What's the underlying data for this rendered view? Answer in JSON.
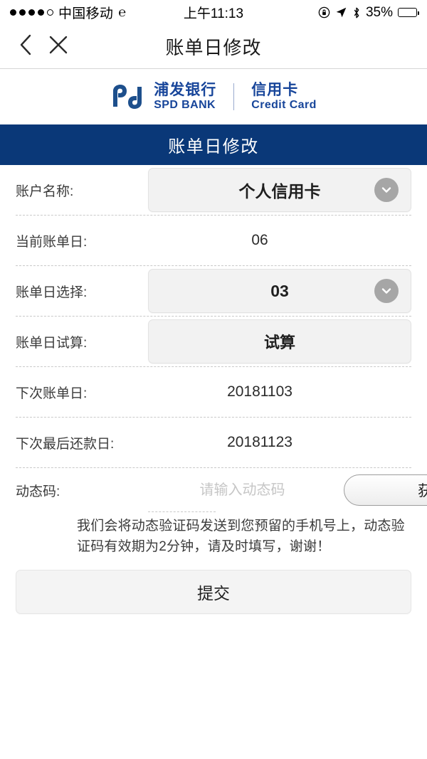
{
  "status_bar": {
    "signal_dots_filled": 4,
    "signal_dots_total": 5,
    "carrier": "中国移动",
    "network_icon": "edge-icon",
    "time": "上午11:13",
    "rotation_lock_icon": "rotation-lock-icon",
    "location_icon": "location-arrow-icon",
    "bluetooth_icon": "bluetooth-icon",
    "battery_percent": "35%",
    "battery_level": 35
  },
  "nav": {
    "back_icon": "chevron-left-icon",
    "close_icon": "close-x-icon",
    "title": "账单日修改"
  },
  "logo": {
    "mark": "spd-pd-logo-icon",
    "name_cn": "浦发银行",
    "name_en": "SPD BANK",
    "product_cn": "信用卡",
    "product_en": "Credit Card",
    "brand_color": "#17459a"
  },
  "banner": {
    "title": "账单日修改",
    "background": "#0a3878"
  },
  "form": {
    "rows": [
      {
        "label": "账户名称:",
        "type": "select",
        "value": "个人信用卡",
        "icon": "chevron-down-circle-icon"
      },
      {
        "label": "当前账单日:",
        "type": "text",
        "value": "06"
      },
      {
        "label": "账单日选择:",
        "type": "select",
        "value": "03",
        "icon": "chevron-down-circle-icon"
      },
      {
        "label": "账单日试算:",
        "type": "button",
        "value": "试算"
      },
      {
        "label": "下次账单日:",
        "type": "text",
        "value": "20181103"
      },
      {
        "label": "下次最后还款日:",
        "type": "text",
        "value": "20181123"
      }
    ],
    "code_row": {
      "label": "动态码:",
      "placeholder": "请输入动态码",
      "value": "",
      "get_button": "获取"
    },
    "hint": "我们会将动态验证码发送到您预留的手机号上，动态验证码有效期为2分钟，请及时填写，谢谢！",
    "submit_label": "提交"
  }
}
